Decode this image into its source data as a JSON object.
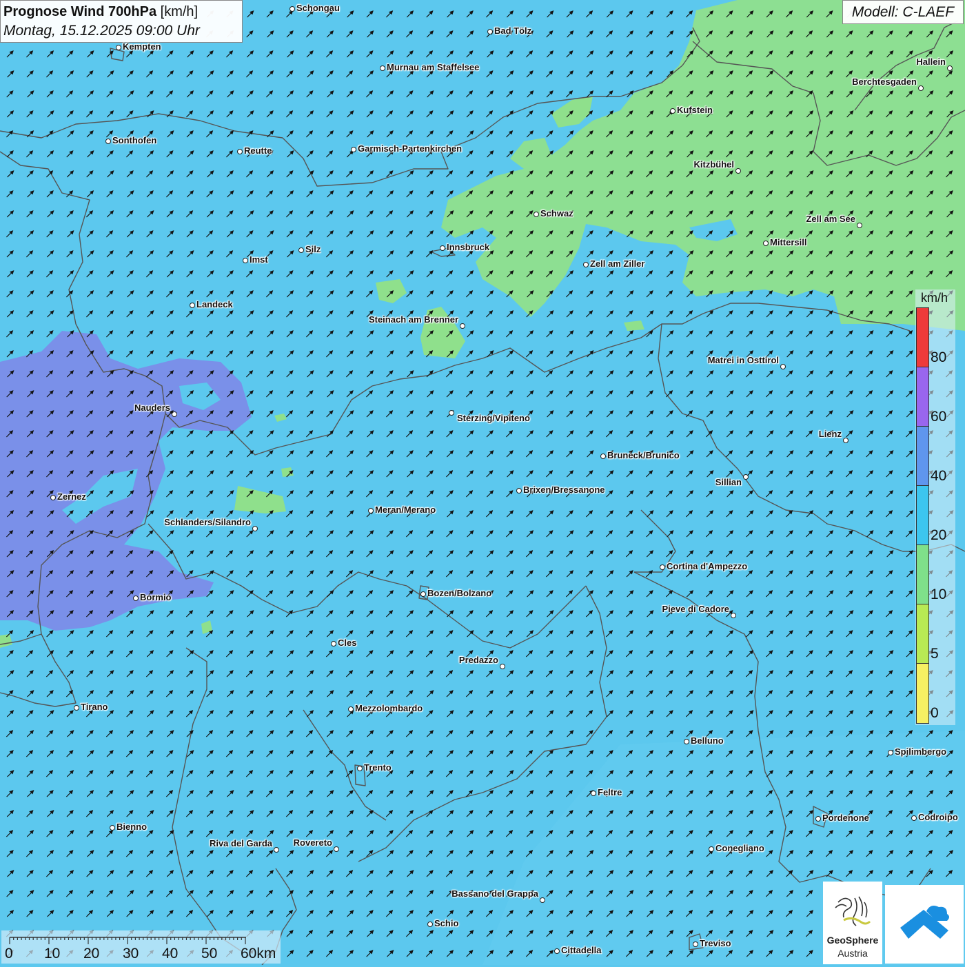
{
  "header": {
    "title_bold": "Prognose Wind 700hPa",
    "title_unit": "[km/h]",
    "datetime": "Montag, 15.12.2025 09:00 Uhr",
    "model": "Modell: C-LAEF"
  },
  "legend": {
    "unit": "km/h",
    "segments": [
      {
        "color": "#ee3a3a"
      },
      {
        "color": "#9966ee"
      },
      {
        "color": "#5f96ee"
      },
      {
        "color": "#3cc6ef"
      },
      {
        "color": "#7fe08a"
      },
      {
        "color": "#b8ea54"
      },
      {
        "color": "#f6f063"
      }
    ],
    "labels": [
      "80",
      "60",
      "40",
      "20",
      "10",
      "5",
      "0"
    ]
  },
  "scale_bar": {
    "labels": [
      "0",
      "10",
      "20",
      "30",
      "40",
      "50",
      "60km"
    ]
  },
  "colors": {
    "field_base": "#5cc8ee",
    "field_green": "#8fe08c",
    "field_purple": "#7d8ae8",
    "border": "#555555"
  },
  "wind_icon": "arrow-northeast-icon",
  "cities": [
    {
      "name": "Schongau"
    },
    {
      "name": "Bad Tölz"
    },
    {
      "name": "Kempten"
    },
    {
      "name": "Murnau am Staffelsee"
    },
    {
      "name": "Hallein"
    },
    {
      "name": "Berchtesgaden"
    },
    {
      "name": "Kufstein"
    },
    {
      "name": "Sonthofen"
    },
    {
      "name": "Reutte"
    },
    {
      "name": "Garmisch-Partenkirchen"
    },
    {
      "name": "Kitzbühel"
    },
    {
      "name": "Schwaz"
    },
    {
      "name": "Zell am See"
    },
    {
      "name": "Innsbruck"
    },
    {
      "name": "Mittersill"
    },
    {
      "name": "Imst"
    },
    {
      "name": "Silz"
    },
    {
      "name": "Zell am Ziller"
    },
    {
      "name": "Landeck"
    },
    {
      "name": "Steinach am Brenner"
    },
    {
      "name": "Matrei in Osttirol"
    },
    {
      "name": "Nauders"
    },
    {
      "name": "Sterzing/Vipiteno"
    },
    {
      "name": "Lienz"
    },
    {
      "name": "Bruneck/Brunico"
    },
    {
      "name": "Sillian"
    },
    {
      "name": "Zernez"
    },
    {
      "name": "Brixen/Bressanone"
    },
    {
      "name": "Meran/Merano"
    },
    {
      "name": "Schlanders/Silandro"
    },
    {
      "name": "Cortina d'Ampezzo"
    },
    {
      "name": "Bozen/Bolzano"
    },
    {
      "name": "Bormio"
    },
    {
      "name": "Pieve di Cadore"
    },
    {
      "name": "Cles"
    },
    {
      "name": "Predazzo"
    },
    {
      "name": "Tirano"
    },
    {
      "name": "Mezzolombardo"
    },
    {
      "name": "Belluno"
    },
    {
      "name": "Spilimbergo"
    },
    {
      "name": "Trento"
    },
    {
      "name": "Feltre"
    },
    {
      "name": "Bienno"
    },
    {
      "name": "Pordenone"
    },
    {
      "name": "Codroipo"
    },
    {
      "name": "Riva del Garda"
    },
    {
      "name": "Rovereto"
    },
    {
      "name": "Conegliano"
    },
    {
      "name": "Bassano del Grappa"
    },
    {
      "name": "Schio"
    },
    {
      "name": "Treviso"
    },
    {
      "name": "Cittadella"
    }
  ],
  "logos": {
    "geosphere_line1": "GeoSphere",
    "geosphere_line2": "Austria"
  }
}
